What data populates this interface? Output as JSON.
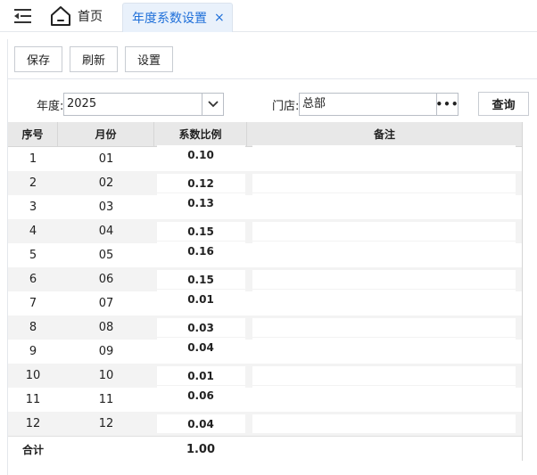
{
  "tabs": {
    "home_label": "首页",
    "active_label": "年度系数设置",
    "close_glyph": "×"
  },
  "toolbar": {
    "save_label": "保存",
    "refresh_label": "刷新",
    "settings_label": "设置"
  },
  "filter": {
    "year_label": "年度:",
    "year_value": "2025",
    "store_label": "门店:",
    "store_value": "总部",
    "more_glyph": "•••",
    "query_label": "查询"
  },
  "grid": {
    "headers": {
      "seq": "序号",
      "month": "月份",
      "ratio": "系数比例",
      "note": "备注"
    },
    "rows": [
      {
        "seq": "1",
        "month": "01",
        "ratio": "0.10",
        "note": ""
      },
      {
        "seq": "2",
        "month": "02",
        "ratio": "0.12",
        "note": ""
      },
      {
        "seq": "3",
        "month": "03",
        "ratio": "0.13",
        "note": ""
      },
      {
        "seq": "4",
        "month": "04",
        "ratio": "0.15",
        "note": ""
      },
      {
        "seq": "5",
        "month": "05",
        "ratio": "0.16",
        "note": ""
      },
      {
        "seq": "6",
        "month": "06",
        "ratio": "0.15",
        "note": ""
      },
      {
        "seq": "7",
        "month": "07",
        "ratio": "0.01",
        "note": ""
      },
      {
        "seq": "8",
        "month": "08",
        "ratio": "0.03",
        "note": ""
      },
      {
        "seq": "9",
        "month": "09",
        "ratio": "0.04",
        "note": ""
      },
      {
        "seq": "10",
        "month": "10",
        "ratio": "0.01",
        "note": ""
      },
      {
        "seq": "11",
        "month": "11",
        "ratio": "0.06",
        "note": ""
      },
      {
        "seq": "12",
        "month": "12",
        "ratio": "0.04",
        "note": ""
      }
    ],
    "total": {
      "label": "合计",
      "value": "1.00"
    }
  },
  "icons": {
    "menu": "menu-fold-icon",
    "home": "home-icon",
    "dropdown": "chevron-down-icon",
    "more": "ellipsis-icon"
  },
  "colors": {
    "accent": "#1e6fd9",
    "active_tab_bg": "#e9f1fb",
    "header_bg": "#e8e8e8",
    "stripe_bg": "#f3f3f3"
  }
}
